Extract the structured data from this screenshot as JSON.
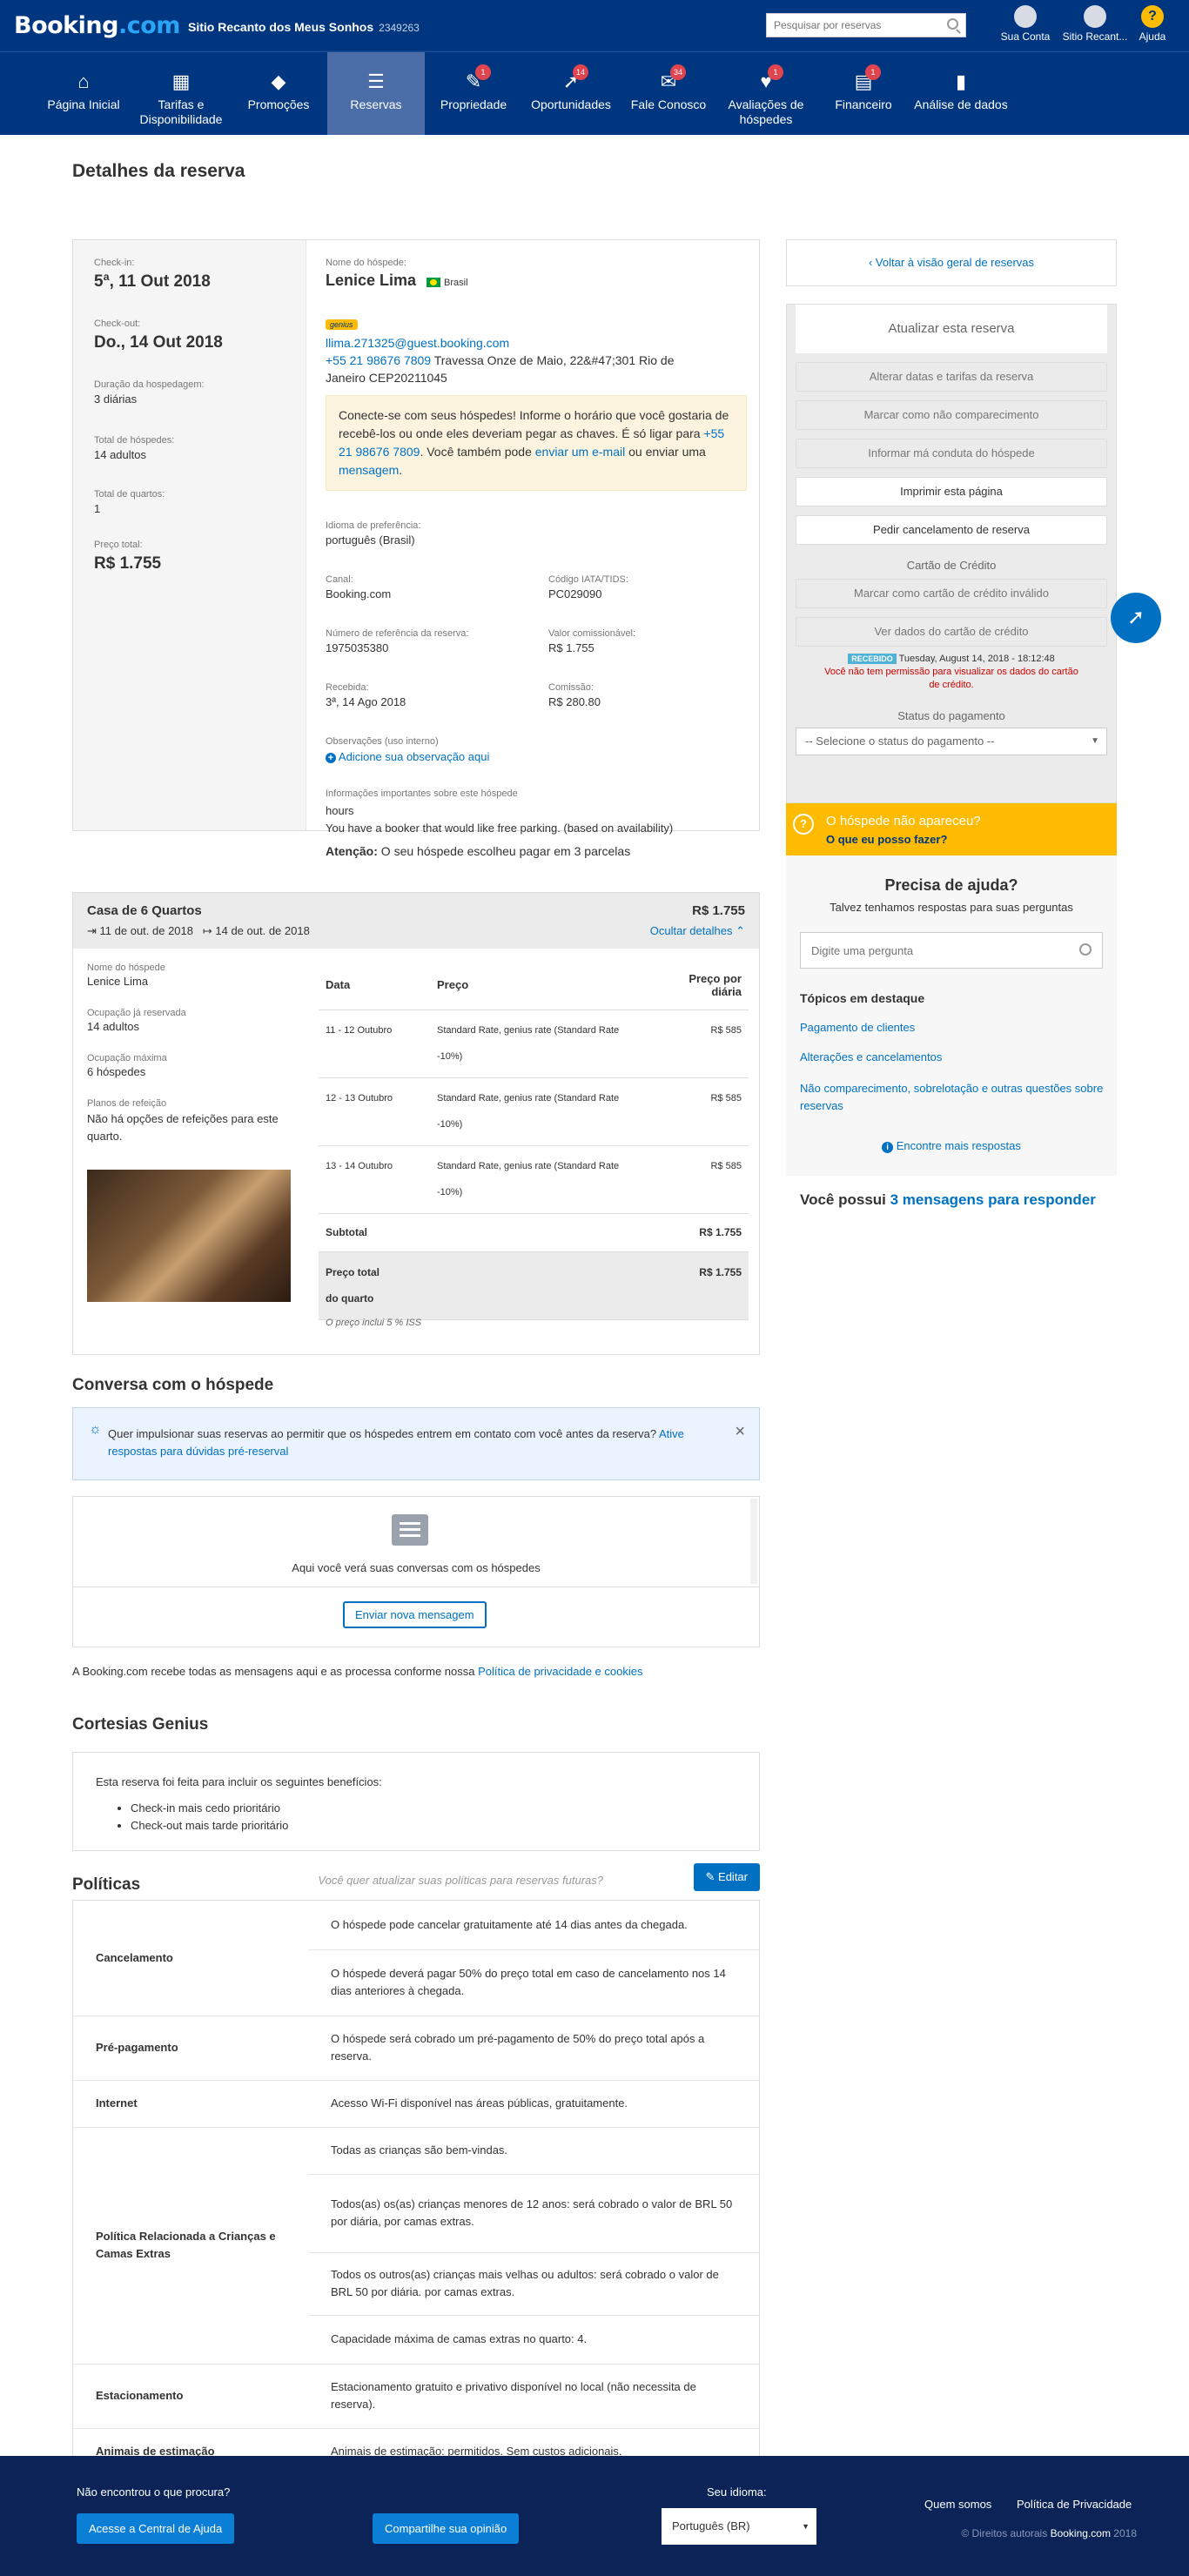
{
  "topbar": {
    "logo_main": "Booking",
    "logo_suffix": ".com",
    "property_name": "Sitio Recanto dos Meus Sonhos",
    "property_id": "2349263",
    "search_placeholder": "Pesquisar por reservas",
    "account_label": "Sua Conta",
    "property_label": "Sitio Recant...",
    "help_label": "Ajuda"
  },
  "nav": [
    {
      "label": "Página Inicial",
      "icon": "home-icon",
      "badge": ""
    },
    {
      "label": "Tarifas e Disponibilidade",
      "icon": "calendar-icon",
      "badge": ""
    },
    {
      "label": "Promoções",
      "icon": "tag-icon",
      "badge": ""
    },
    {
      "label": "Reservas",
      "icon": "list-icon",
      "badge": ""
    },
    {
      "label": "Propriedade",
      "icon": "wrench-icon",
      "badge": "1"
    },
    {
      "label": "Oportunidades",
      "icon": "rocket-icon",
      "badge": "14"
    },
    {
      "label": "Fale Conosco",
      "icon": "mail-icon",
      "badge": "34"
    },
    {
      "label": "Avaliações de hóspedes",
      "icon": "heart-icon",
      "badge": "1"
    },
    {
      "label": "Financeiro",
      "icon": "document-icon",
      "badge": "1"
    },
    {
      "label": "Análise de dados",
      "icon": "bar-chart-icon",
      "badge": ""
    }
  ],
  "page_title": "Detalhes da reserva",
  "booking": {
    "checkin_label": "Check-in:",
    "checkin": "5ª, 11 Out 2018",
    "checkout_label": "Check-out:",
    "checkout": "Do., 14 Out 2018",
    "duration_label": "Duração da hospedagem:",
    "duration": "3 diárias",
    "guests_label": "Total de hóspedes:",
    "guests": "14 adultos",
    "rooms_label": "Total de quartos:",
    "rooms": "1",
    "price_label": "Preço total:",
    "price": "R$ 1.755",
    "guest_name_label": "Nome do hóspede:",
    "guest_name": "Lenice Lima",
    "country": "Brasil",
    "genius": "genius",
    "email": "llima.271325@guest.booking.com",
    "phone": "+55 21 98676 7809",
    "address": "Travessa Onze de Maio, 22&#47;301 Rio de Janeiro CEP20211045",
    "connect_text1": "Conecte-se com seus hóspedes! Informe o horário que você gostaria de recebê-los ou onde eles deveriam pegar as chaves. É só ligar para",
    "connect_phone": "+55 21 98676 7809",
    "connect_text2": ". Você também pode",
    "connect_link1": "enviar um e-mail",
    "connect_text3": "ou enviar uma",
    "connect_link2": "mensagem",
    "connect_text4": ".",
    "lang_label": "Idioma de preferência:",
    "lang": "português (Brasil)",
    "channel_label": "Canal:",
    "channel": "Booking.com",
    "iata_label": "Código IATA/TIDS:",
    "iata": "PC029090",
    "ref_label": "Número de referência da reserva:",
    "ref": "1975035380",
    "commissionable_label": "Valor comissionável:",
    "commissionable": "R$ 1.755",
    "received_label": "Recebida:",
    "received": "3ª, 14 Ago 2018",
    "commission_label": "Comissão:",
    "commission": "R$ 280.80",
    "notes_label": "Observações (uso interno)",
    "notes_link": "Adicione sua observação aqui",
    "important_label": "Informações importantes sobre este hóspede",
    "important1": "hours",
    "important2": "You have a booker that would like free parking. (based on availability)",
    "attention_label": "Atenção:",
    "attention": "O seu hóspede escolheu pagar em 3 parcelas"
  },
  "room": {
    "title": "Casa de 6 Quartos",
    "price": "R$ 1.755",
    "checkin": "11 de out. de 2018",
    "checkout": "14 de out. de 2018",
    "hide_details": "Ocultar detalhes",
    "guest_label": "Nome do hóspede",
    "guest": "Lenice Lima",
    "occupancy_label": "Ocupação já reservada",
    "occupancy": "14 adultos",
    "max_label": "Ocupação máxima",
    "max": "6 hóspedes",
    "meal_label": "Planos de refeição",
    "meal": "Não há opções de refeições para este quarto.",
    "col_date": "Data",
    "col_price": "Preço",
    "col_daily": "Preço por diária",
    "rows": [
      {
        "date": "11 - 12 Outubro",
        "rate": "Standard Rate, genius rate (Standard Rate -10%)",
        "price": "R$ 585"
      },
      {
        "date": "12 - 13 Outubro",
        "rate": "Standard Rate, genius rate (Standard Rate -10%)",
        "price": "R$ 585"
      },
      {
        "date": "13 - 14 Outubro",
        "rate": "Standard Rate, genius rate (Standard Rate -10%)",
        "price": "R$ 585"
      }
    ],
    "subtotal_label": "Subtotal",
    "subtotal": "R$ 1.755",
    "total_label": "Preço total do quarto",
    "total": "R$ 1.755",
    "tax_note": "O preço inclui 5 % ISS"
  },
  "conversation": {
    "title": "Conversa com o hóspede",
    "tip": "Quer impulsionar suas reservas ao permitir que os hóspedes entrem em contato com você antes da reserva?",
    "tip_link": "Ative respostas para dúvidas pré-reserval",
    "empty": "Aqui você verá suas conversas com os hóspedes",
    "new_button": "Enviar nova mensagem",
    "privacy_text": "A Booking.com recebe todas as mensagens aqui e as processa conforme nossa",
    "privacy_link": "Política de privacidade e cookies"
  },
  "genius_section": {
    "title": "Cortesias Genius",
    "intro": "Esta reserva foi feita para incluir os seguintes benefícios:",
    "items": [
      "Check-in mais cedo prioritário",
      "Check-out mais tarde prioritário"
    ]
  },
  "policies": {
    "title": "Políticas",
    "prompt": "Você quer atualizar suas políticas para reservas futuras?",
    "edit_button": "Editar",
    "rows": [
      {
        "key": "Cancelamento",
        "values": [
          "O hóspede pode cancelar gratuitamente até 14 dias antes da chegada.",
          "O hóspede deverá pagar 50% do preço total em caso de cancelamento nos 14 dias anteriores à chegada."
        ]
      },
      {
        "key": "Pré-pagamento",
        "values": [
          "O hóspede será cobrado um pré-pagamento de 50% do preço total após a reserva."
        ]
      },
      {
        "key": "Internet",
        "values": [
          "Acesso Wi-Fi disponível nas áreas públicas, gratuitamente."
        ]
      },
      {
        "key": "Política Relacionada a Crianças e Camas Extras",
        "values": [
          "Todas as crianças são bem-vindas.",
          "Todos(as) os(as) crianças menores de 12 anos: será cobrado o valor de BRL 50 por diária, por camas extras.",
          "Todos os outros(as) crianças mais velhas ou adultos: será cobrado o valor de BRL 50 por diária. por camas extras.",
          "Capacidade máxima de camas extras no quarto: 4."
        ]
      },
      {
        "key": "Estacionamento",
        "values": [
          "Estacionamento gratuito e privativo disponível no local (não necessita de reserva)."
        ]
      },
      {
        "key": "Animais de estimação",
        "values": [
          "Animais de estimação: permitidos. Sem custos adicionais."
        ]
      }
    ]
  },
  "sidebar": {
    "back_link": "Voltar à visão geral de reservas",
    "update_title": "Atualizar esta reserva",
    "buttons": [
      "Alterar datas e tarifas da reserva",
      "Marcar como não comparecimento",
      "Informar má conduta do hóspede",
      "Imprimir esta página",
      "Pedir cancelamento de reserva"
    ],
    "card_title": "Cartão de Crédito",
    "card_buttons": [
      "Marcar como cartão de crédito inválido",
      "Ver dados do cartão de crédito"
    ],
    "received_badge": "RECEBIDO",
    "received_time": "Tuesday, August 14, 2018 - 18:12:48",
    "no_permission": "Você não tem permissão para visualizar os dados do cartão de crédito.",
    "payment_title": "Status do pagamento",
    "payment_select": "-- Selecione o status do pagamento --",
    "noshow_title": "O hóspede não apareceu?",
    "noshow_link": "O que eu posso fazer?",
    "help_title": "Precisa de ajuda?",
    "help_sub": "Talvez tenhamos respostas para suas perguntas",
    "help_placeholder": "Digite uma pergunta",
    "topics_title": "Tópicos em destaque",
    "topics": [
      "Pagamento de clientes",
      "Alterações e cancelamentos",
      "Não comparecimento, sobrelotação e outras questões sobre reservas"
    ],
    "more_answers": "Encontre mais respostas",
    "messages_prefix": "Você possui",
    "messages_link": "3 mensagens para responder"
  },
  "footer": {
    "not_found": "Não encontrou o que procura?",
    "help_center": "Acesse a Central de Ajuda",
    "share": "Compartilhe sua opinião",
    "language_label": "Seu idioma:",
    "language": "Português (BR)",
    "about": "Quem somos",
    "privacy": "Política de Privacidade",
    "copyright_prefix": "© Direitos autorais",
    "copyright_brand": "Booking.com",
    "copyright_year": "2018"
  }
}
